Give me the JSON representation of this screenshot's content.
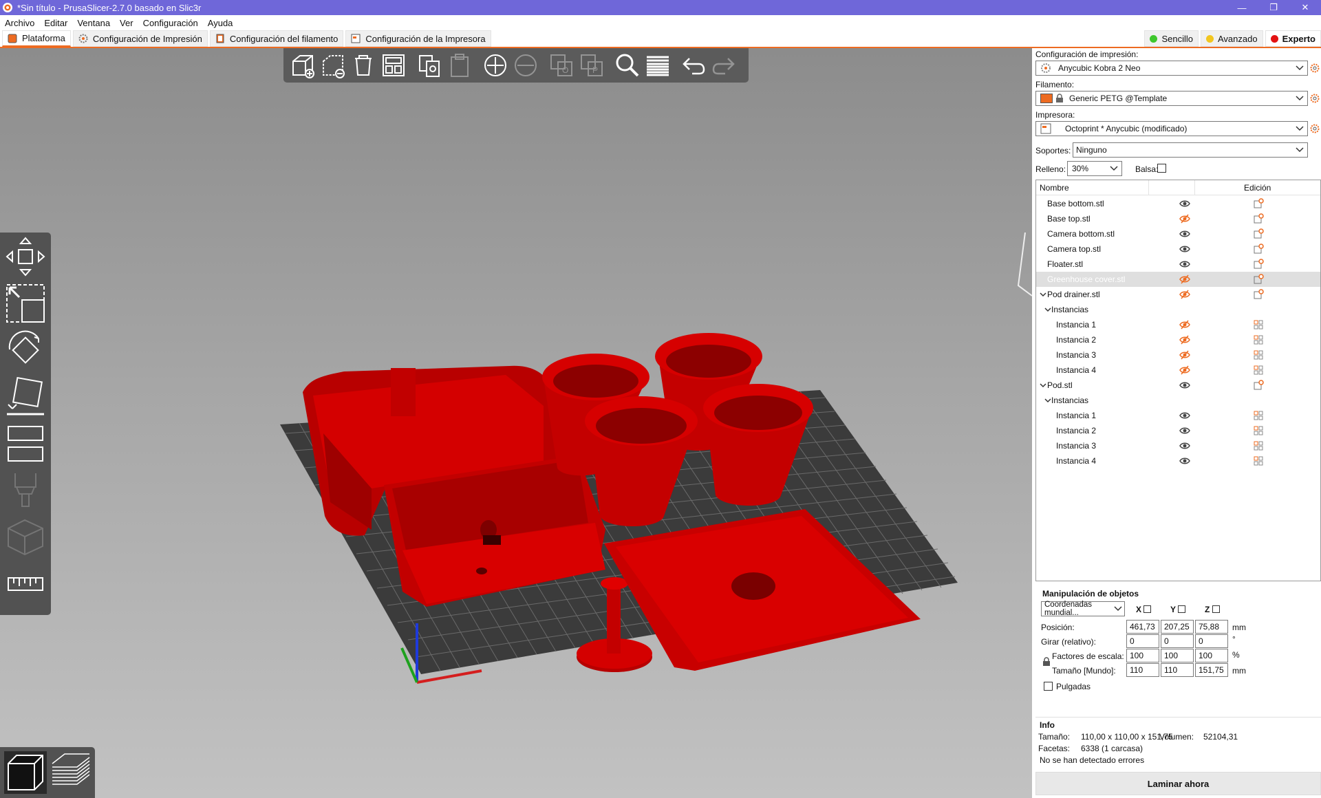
{
  "window": {
    "title": "*Sin título - PrusaSlicer-2.7.0 basado en Slic3r",
    "controls": [
      "minimize",
      "maximize",
      "close"
    ]
  },
  "menu": [
    "Archivo",
    "Editar",
    "Ventana",
    "Ver",
    "Configuración",
    "Ayuda"
  ],
  "tabs": [
    {
      "label": "Plataforma",
      "icon": "plater-icon",
      "active": true
    },
    {
      "label": "Configuración de Impresión",
      "icon": "print-settings-icon"
    },
    {
      "label": "Configuración del filamento",
      "icon": "filament-icon"
    },
    {
      "label": "Configuración de la Impresora",
      "icon": "printer-icon"
    }
  ],
  "modes": [
    {
      "label": "Sencillo",
      "color": "#3ec72d"
    },
    {
      "label": "Avanzado",
      "color": "#f2c61f"
    },
    {
      "label": "Experto",
      "color": "#e31212",
      "active": true
    }
  ],
  "toolbar": [
    "add",
    "delete",
    "delete-all",
    "arrange",
    "copy",
    "paste",
    "add-instance",
    "remove-instance",
    "split-objects",
    "split-parts",
    "search",
    "variable-layer-height",
    "undo",
    "redo"
  ],
  "left_tools": [
    "move",
    "scale",
    "rotate",
    "place-on-face",
    "cut",
    "paint-supports",
    "seam",
    "measure"
  ],
  "view_modes": [
    "3d-view",
    "preview"
  ],
  "settings": {
    "print_label": "Configuración de impresión:",
    "print_value": "Anycubic Kobra 2 Neo",
    "filament_label": "Filamento:",
    "filament_value": "Generic PETG @Template",
    "filament_color": "#ed6b21",
    "printer_label": "Impresora:",
    "printer_value": "Octoprint * Anycubic (modificado)",
    "supports_label": "Soportes:",
    "supports_value": "Ninguno",
    "infill_label": "Relleno:",
    "infill_value": "30%",
    "brim_label": "Balsa:"
  },
  "object_list": {
    "col_name": "Nombre",
    "col_edit": "Edición",
    "rows": [
      {
        "name": "Base bottom.stl",
        "level": 0,
        "visible": true,
        "edit": "settings"
      },
      {
        "name": "Base top.stl",
        "level": 0,
        "visible": false,
        "edit": "settings"
      },
      {
        "name": "Camera bottom.stl",
        "level": 0,
        "visible": true,
        "edit": "settings"
      },
      {
        "name": "Camera top.stl",
        "level": 0,
        "visible": true,
        "edit": "settings"
      },
      {
        "name": "Floater.stl",
        "level": 0,
        "visible": true,
        "edit": "settings"
      },
      {
        "name": "Greenhouse cover.stl",
        "level": 0,
        "visible": false,
        "edit": "settings",
        "selected": true
      },
      {
        "name": "Pod drainer.stl",
        "level": 0,
        "visible": false,
        "edit": "settings",
        "expander": true
      },
      {
        "name": "Instancias",
        "level": 1,
        "expander": true
      },
      {
        "name": "Instancia 1",
        "level": 2,
        "visible": false,
        "edit": "instance"
      },
      {
        "name": "Instancia 2",
        "level": 2,
        "visible": false,
        "edit": "instance"
      },
      {
        "name": "Instancia 3",
        "level": 2,
        "visible": false,
        "edit": "instance"
      },
      {
        "name": "Instancia 4",
        "level": 2,
        "visible": false,
        "edit": "instance"
      },
      {
        "name": "Pod.stl",
        "level": 0,
        "visible": true,
        "edit": "settings",
        "expander": true
      },
      {
        "name": "Instancias",
        "level": 1,
        "expander": true
      },
      {
        "name": "Instancia 1",
        "level": 2,
        "visible": true,
        "edit": "instance"
      },
      {
        "name": "Instancia 2",
        "level": 2,
        "visible": true,
        "edit": "instance"
      },
      {
        "name": "Instancia 3",
        "level": 2,
        "visible": true,
        "edit": "instance"
      },
      {
        "name": "Instancia 4",
        "level": 2,
        "visible": true,
        "edit": "instance"
      }
    ]
  },
  "manipulation": {
    "title": "Manipulación de objetos",
    "coords_value": "Coordenadas mundial...",
    "axes": [
      "X",
      "Y",
      "Z"
    ],
    "position_label": "Posición:",
    "position": [
      "461,73",
      "207,25",
      "75,88"
    ],
    "position_unit": "mm",
    "rotate_label": "Girar (relativo):",
    "rotate": [
      "0",
      "0",
      "0"
    ],
    "rotate_unit": "°",
    "scale_label": "Factores de escala:",
    "scale": [
      "100",
      "100",
      "100"
    ],
    "scale_unit": "%",
    "size_label": "Tamaño [Mundo]:",
    "size": [
      "110",
      "110",
      "151,75"
    ],
    "size_unit": "mm",
    "inches_label": "Pulgadas"
  },
  "info": {
    "title": "Info",
    "size_label": "Tamaño:",
    "size_value": "110,00 x 110,00 x 151,75",
    "volume_label": "Volumen:",
    "volume_value": "52104,31",
    "facets_label": "Facetas:",
    "facets_value": "6338 (1 carcasa)",
    "errors_text": "No se han detectado errores"
  },
  "slice_button": "Laminar ahora",
  "colors": {
    "titlebar": "#6f67d9",
    "accent": "#ed6b21",
    "model_red": "#c80000",
    "bed": "#3a3a3a"
  }
}
